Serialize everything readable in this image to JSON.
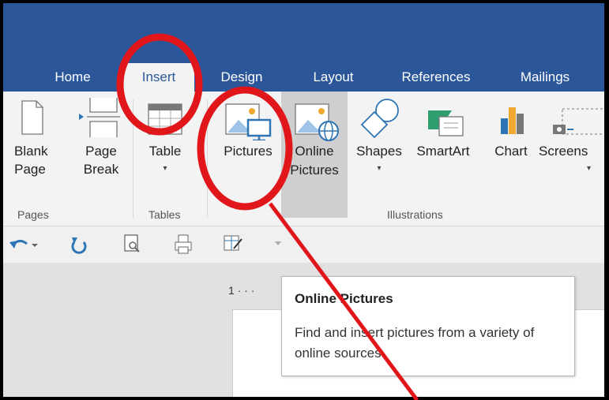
{
  "tabs": [
    {
      "label": "Home"
    },
    {
      "label": "Insert"
    },
    {
      "label": "Design"
    },
    {
      "label": "Layout"
    },
    {
      "label": "References"
    },
    {
      "label": "Mailings"
    }
  ],
  "ribbon": {
    "blank_page": {
      "line1": "Blank",
      "line2": "Page"
    },
    "page_break": {
      "line1": "Page",
      "line2": "Break"
    },
    "table": {
      "label": "Table",
      "dropdown": "▾"
    },
    "pictures": {
      "label": "Pictures"
    },
    "online_pictures": {
      "line1": "Online",
      "line2": "Pictures"
    },
    "shapes": {
      "label": "Shapes",
      "dropdown": "▾"
    },
    "smartart": {
      "label": "SmartArt"
    },
    "chart": {
      "label": "Chart"
    },
    "screenshot": {
      "label": "Screens",
      "dropdown": "▾"
    },
    "groups": {
      "pages": "Pages",
      "tables": "Tables",
      "illustrations": "Illustrations"
    }
  },
  "ruler": {
    "mark": "1 · · ·"
  },
  "tooltip": {
    "title": "Online Pictures",
    "description": "Find and insert pictures from a variety of online sources."
  },
  "colors": {
    "brand": "#2b579a",
    "annotation": "#e0161b",
    "icon_blue": "#2e75b6",
    "icon_orange": "#f0a830"
  }
}
